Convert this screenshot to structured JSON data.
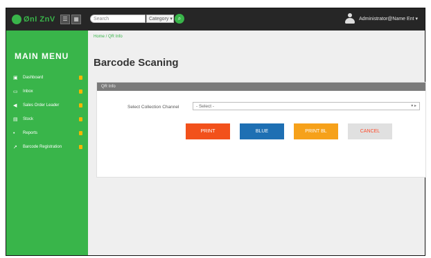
{
  "topbar": {
    "logo_text": "ØnI ZnV",
    "btn1": "☰",
    "btn2": "▦",
    "search_placeholder": "Search",
    "category_label": "Category ▾",
    "user_name": "Administrator@Name Ent ▾"
  },
  "sidebar": {
    "title": "MAIN MENU",
    "items": [
      {
        "icon": "▣",
        "label": "Dashboard"
      },
      {
        "icon": "▭",
        "label": "Inbox"
      },
      {
        "icon": "◀",
        "label": "Sales Order Leader"
      },
      {
        "icon": "▤",
        "label": "Stock"
      },
      {
        "icon": "•",
        "label": "Reports"
      },
      {
        "icon": "↗",
        "label": "Barcode Registration"
      }
    ]
  },
  "content": {
    "breadcrumb": "Home / QR Info",
    "page_title": "Barcode Scaning",
    "panel_title": "QR Info",
    "field_label": "Select Collection Channel",
    "field_value": "- Select -",
    "field_caret": "▾ ▸",
    "buttons": {
      "print": "PRINT",
      "blue": "BLUE",
      "orange": "PRINT BL",
      "light": "CANCEL"
    }
  },
  "colors": {
    "accent_green": "#39b54a",
    "topbar": "#262626",
    "button_print": "#f2511b",
    "button_blue": "#1e6fb3",
    "button_orange": "#f6a11a",
    "button_light": "#e0e0e0"
  },
  "icons": [
    "logo-icon",
    "menu-icon",
    "grid-icon",
    "search-icon",
    "user-icon",
    "dashboard-icon",
    "inbox-icon",
    "order-icon",
    "stock-icon",
    "reports-icon",
    "barcode-icon",
    "chevron-down-icon"
  ]
}
